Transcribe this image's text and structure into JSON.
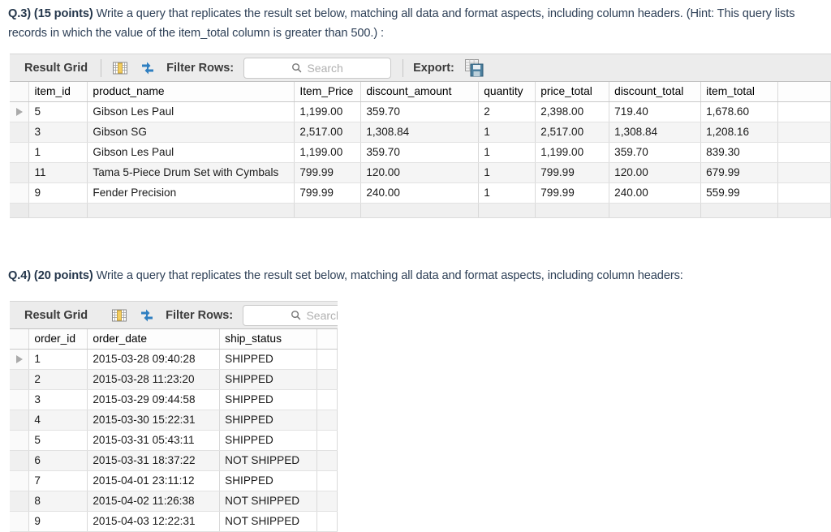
{
  "questions": {
    "q3": {
      "label": "Q.3) (15 points)",
      "text": " Write a query that replicates the result set below, matching all data and format aspects, including column headers. (Hint: This query lists records in which the value of the item_total column is greater than 500.) :"
    },
    "q4": {
      "label": "Q.4) (20 points)",
      "text": " Write a query that replicates the result set below, matching all data and format aspects, including column headers:"
    }
  },
  "toolbar": {
    "title": "Result Grid",
    "filter_label": "Filter Rows:",
    "search_placeholder": "Search",
    "export_label": "Export:",
    "icons": {
      "columns": "columns-icon",
      "refresh": "refresh-icon",
      "search": "search-icon",
      "export": "export-icon"
    }
  },
  "grid1": {
    "columns": [
      "item_id",
      "product_name",
      "Item_Price",
      "discount_amount",
      "quantity",
      "price_total",
      "discount_total",
      "item_total"
    ],
    "rows": [
      [
        "5",
        "Gibson Les Paul",
        "1,199.00",
        "359.70",
        "2",
        "2,398.00",
        "719.40",
        "1,678.60"
      ],
      [
        "3",
        "Gibson SG",
        "2,517.00",
        "1,308.84",
        "1",
        "2,517.00",
        "1,308.84",
        "1,208.16"
      ],
      [
        "1",
        "Gibson Les Paul",
        "1,199.00",
        "359.70",
        "1",
        "1,199.00",
        "359.70",
        "839.30"
      ],
      [
        "11",
        "Tama 5-Piece Drum Set with Cymbals",
        "799.99",
        "120.00",
        "1",
        "799.99",
        "120.00",
        "679.99"
      ],
      [
        "9",
        "Fender Precision",
        "799.99",
        "240.00",
        "1",
        "799.99",
        "240.00",
        "559.99"
      ]
    ],
    "selected_row_index": 0
  },
  "grid2": {
    "columns": [
      "order_id",
      "order_date",
      "ship_status"
    ],
    "rows": [
      [
        "1",
        "2015-03-28 09:40:28",
        "SHIPPED"
      ],
      [
        "2",
        "2015-03-28 11:23:20",
        "SHIPPED"
      ],
      [
        "3",
        "2015-03-29 09:44:58",
        "SHIPPED"
      ],
      [
        "4",
        "2015-03-30 15:22:31",
        "SHIPPED"
      ],
      [
        "5",
        "2015-03-31 05:43:11",
        "SHIPPED"
      ],
      [
        "6",
        "2015-03-31 18:37:22",
        "NOT SHIPPED"
      ],
      [
        "7",
        "2015-04-01 23:11:12",
        "SHIPPED"
      ],
      [
        "8",
        "2015-04-02 11:26:38",
        "NOT SHIPPED"
      ],
      [
        "9",
        "2015-04-03 12:22:31",
        "NOT SHIPPED"
      ]
    ],
    "selected_row_index": 0
  },
  "colors": {
    "prose": "#2e4057",
    "toolbar_bg": "#ececec",
    "alt_row": "#f5f5f5",
    "accent_blue": "#2f7fc1",
    "accent_yellow": "#f0c040"
  }
}
